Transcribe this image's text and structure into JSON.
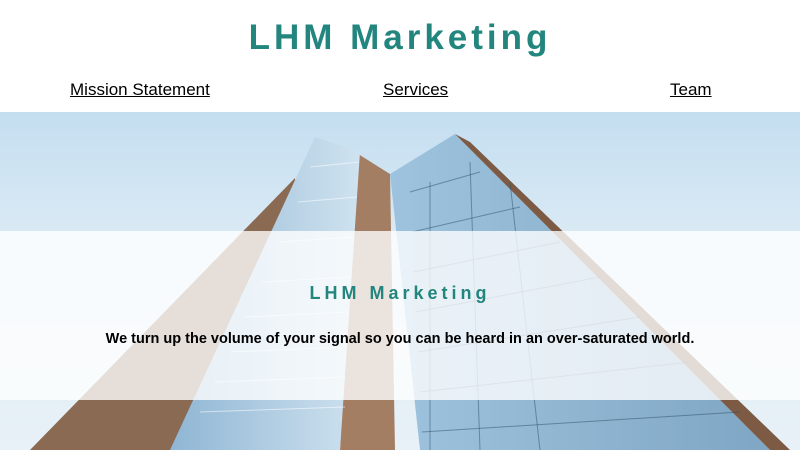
{
  "header": {
    "title": "LHM Marketing"
  },
  "nav": {
    "items": [
      {
        "label": "Mission Statement"
      },
      {
        "label": "Services"
      },
      {
        "label": "Team"
      }
    ]
  },
  "hero": {
    "title": "LHM Marketing",
    "tagline": "We turn up the volume of your signal so you can be heard in an over-saturated world.",
    "image": "skyscraper-photo"
  },
  "colors": {
    "brand": "#22857e",
    "text": "#000000",
    "background": "#ffffff",
    "sky": "#c4def0"
  }
}
